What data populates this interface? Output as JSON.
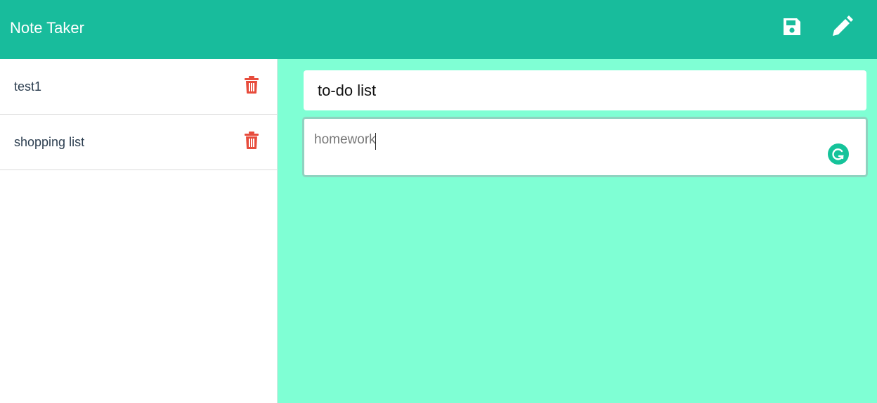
{
  "navbar": {
    "brand": "Note Taker",
    "save_icon": "floppy-disk-icon",
    "new_icon": "pencil-icon",
    "bg_color": "#18bc9c"
  },
  "sidebar": {
    "notes": [
      {
        "title": "test1",
        "delete_icon": "trash-icon"
      },
      {
        "title": "shopping list",
        "delete_icon": "trash-icon"
      }
    ],
    "delete_color": "#e74c3c"
  },
  "editor": {
    "title_value": "to-do list",
    "text_value": "homework",
    "bg_color": "#7fffd4",
    "extension_icon": "grammarly-icon"
  }
}
